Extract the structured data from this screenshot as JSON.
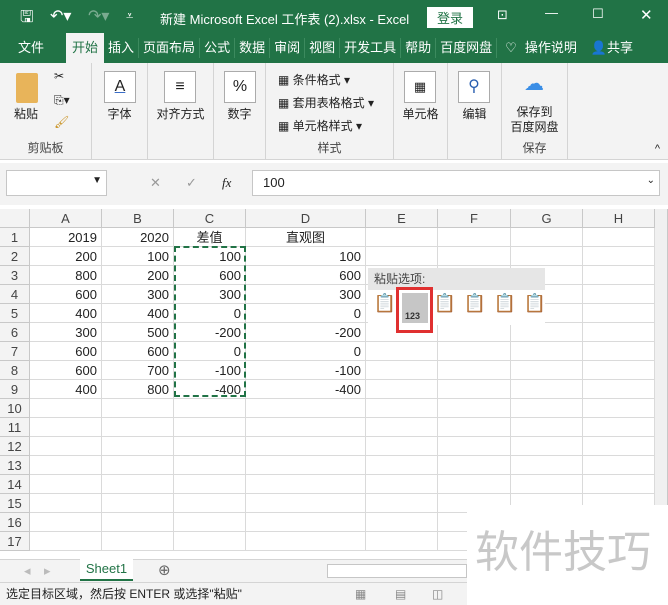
{
  "title": {
    "text": "新建 Microsoft Excel 工作表 (2).xlsx  -  Excel",
    "login": "登录"
  },
  "menu": [
    "文件",
    "开始",
    "插入",
    "页面布局",
    "公式",
    "数据",
    "审阅",
    "视图",
    "开发工具",
    "帮助",
    "百度网盘",
    "操作说明",
    "共享"
  ],
  "ribbon": {
    "paste": "粘贴",
    "clipboard": "剪贴板",
    "font": "字体",
    "align": "对齐方式",
    "number": "数字",
    "cond": "条件格式",
    "table": "套用表格格式",
    "cellstyle": "单元格样式",
    "styles": "样式",
    "cells": "单元格",
    "edit": "编辑",
    "save1": "保存到",
    "save2": "百度网盘",
    "save": "保存"
  },
  "formula": {
    "namebox": "",
    "fx": "fx",
    "value": "100"
  },
  "columns": [
    "A",
    "B",
    "C",
    "D",
    "E",
    "F",
    "G",
    "H"
  ],
  "rows": [
    [
      "2019",
      "2020",
      "差值",
      "直观图"
    ],
    [
      "200",
      "100",
      "100",
      "100"
    ],
    [
      "800",
      "200",
      "600",
      "600"
    ],
    [
      "600",
      "300",
      "300",
      "300"
    ],
    [
      "400",
      "400",
      "0",
      "0"
    ],
    [
      "300",
      "500",
      "-200",
      "-200"
    ],
    [
      "600",
      "600",
      "0",
      "0"
    ],
    [
      "600",
      "700",
      "-100",
      "-100"
    ],
    [
      "400",
      "800",
      "-400",
      "-400"
    ]
  ],
  "row_count": 17,
  "paste_options": {
    "label": "粘贴选项:",
    "icons": [
      "paste-icon",
      "paste-values-icon",
      "paste-formulas-icon",
      "paste-transpose-icon",
      "paste-formatting-icon",
      "paste-link-icon"
    ],
    "selected": "123"
  },
  "sheet": {
    "tab": "Sheet1"
  },
  "status": "选定目标区域，然后按 ENTER 或选择\"粘贴\"",
  "watermark": "软件技巧",
  "colors": {
    "brand": "#217346",
    "highlight": "#e03030"
  }
}
